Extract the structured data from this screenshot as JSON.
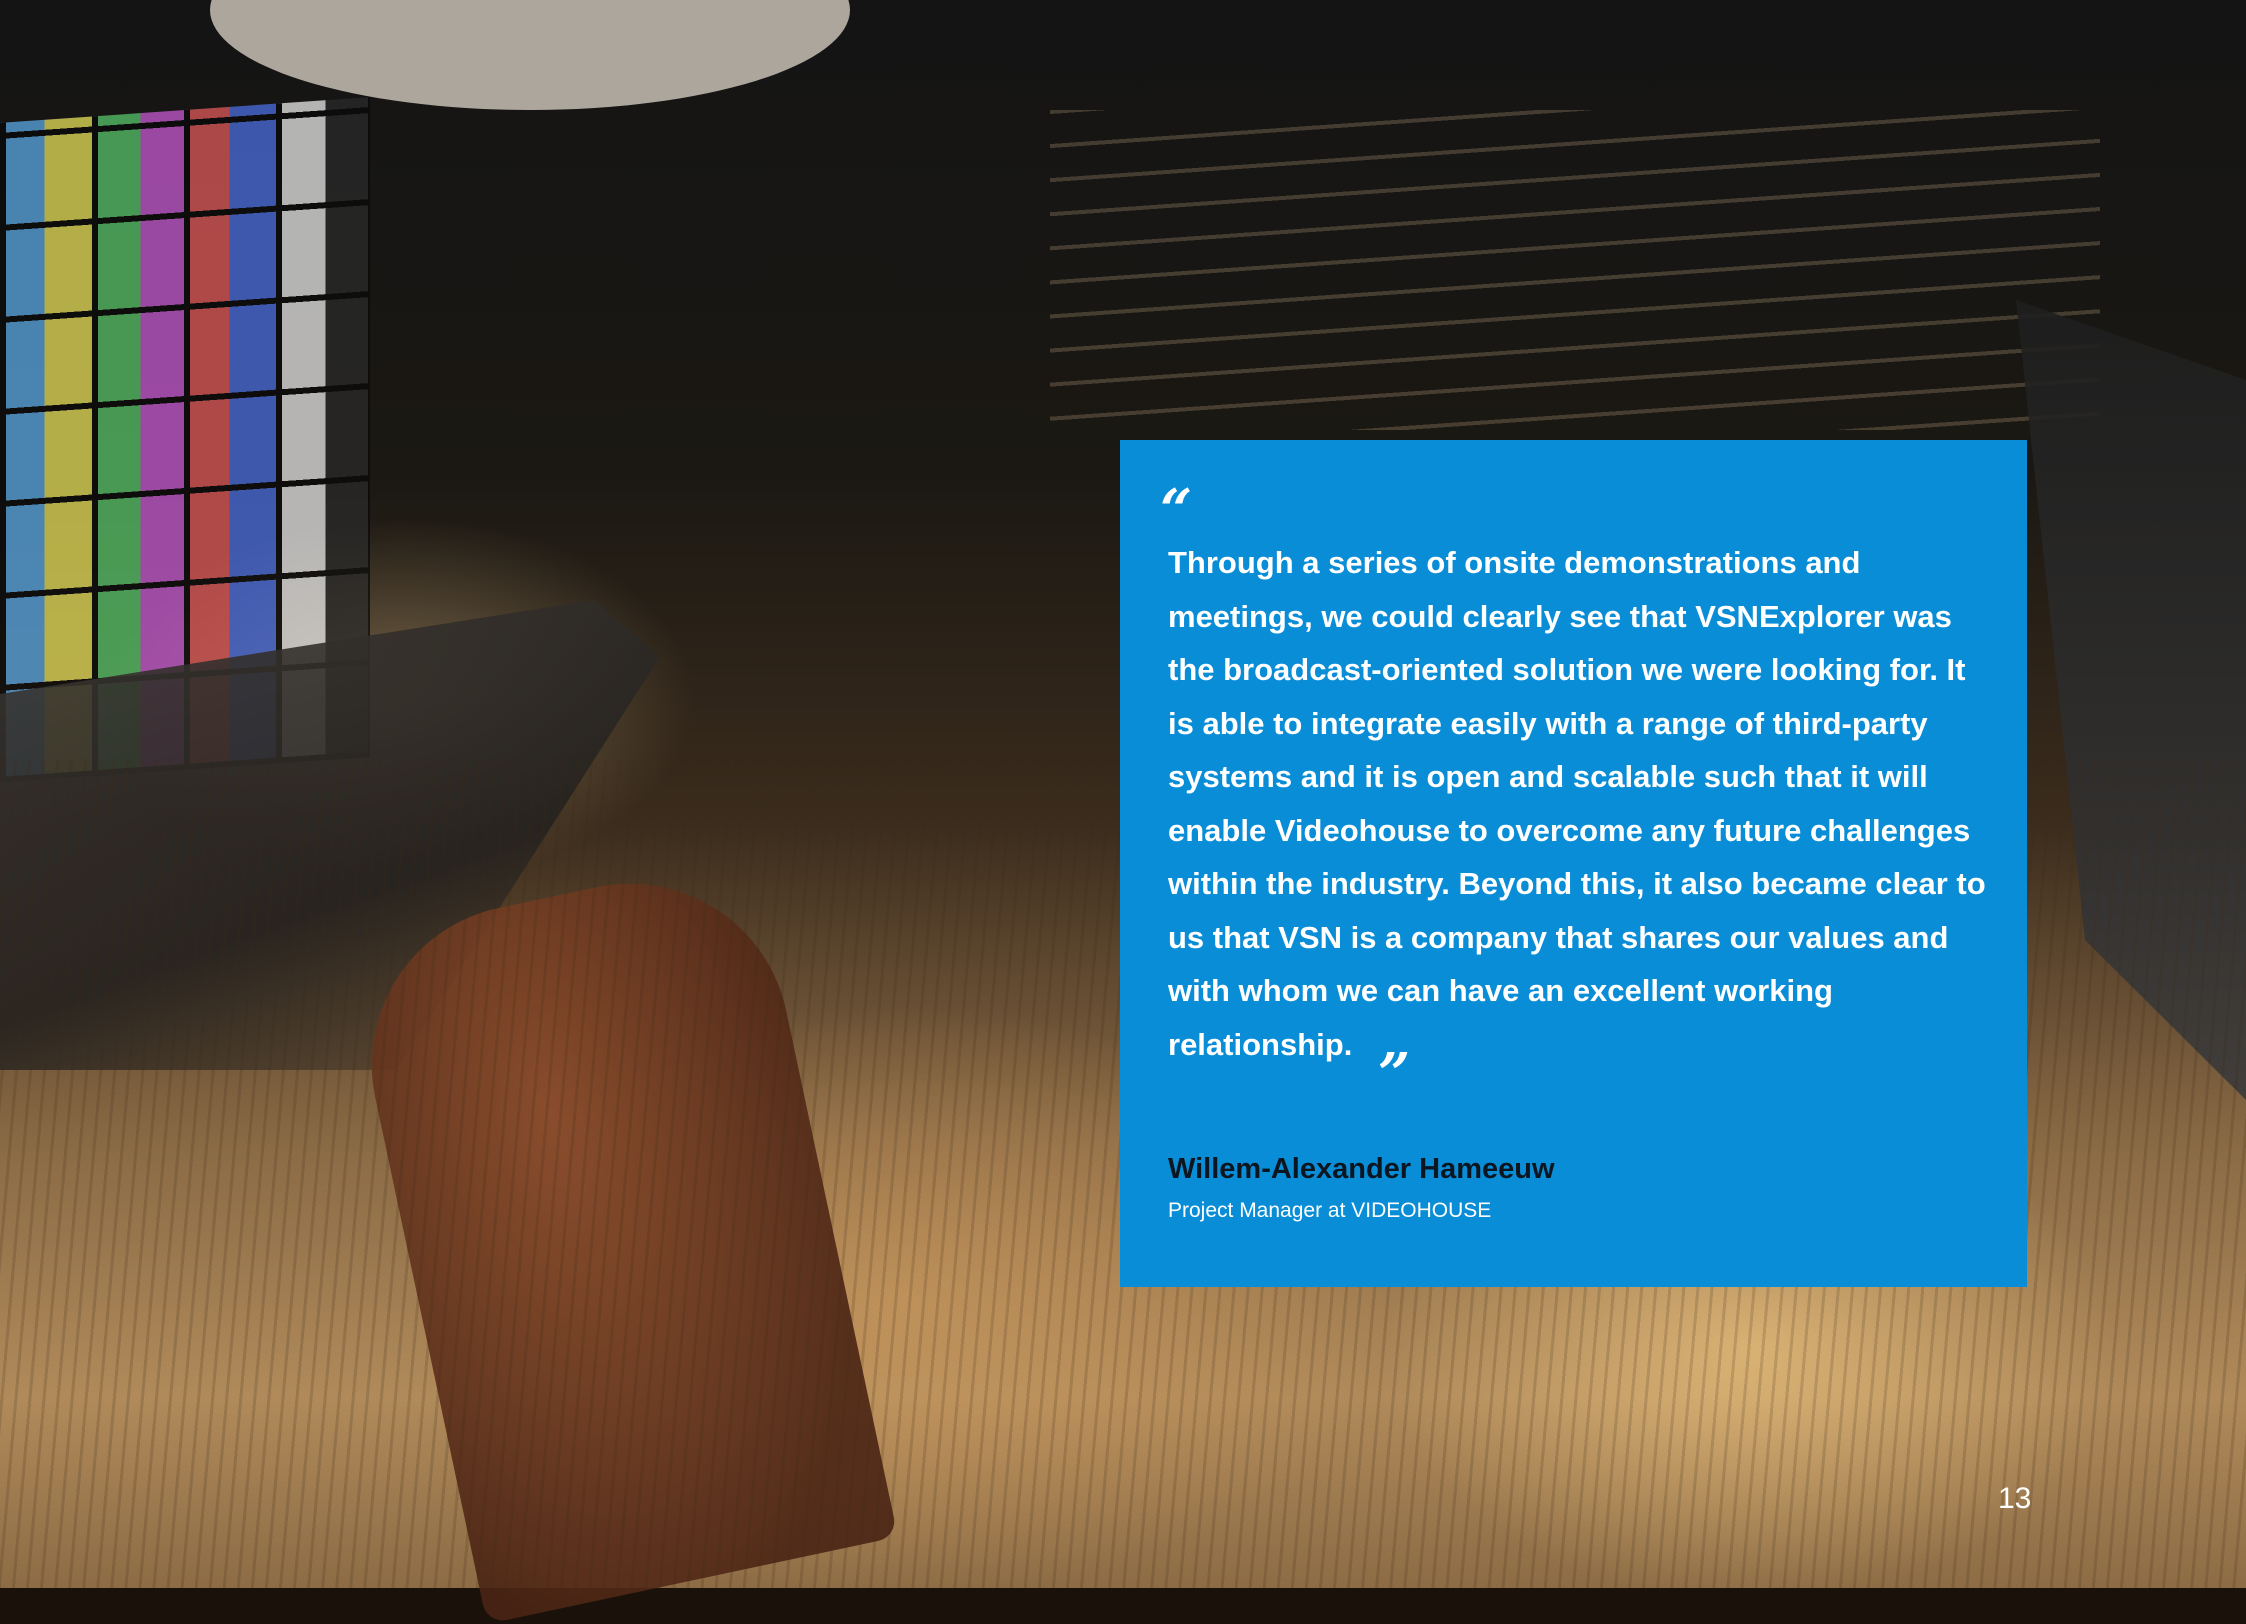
{
  "quote": {
    "open_mark": "“",
    "text": "Through a series of onsite demonstrations and meetings, we could clearly see that VSNExplorer was the broadcast-oriented solution we were looking for. It is able to integrate easily with a range of third-party systems and it is open and scalable such that it will enable Videohouse to overcome any future challenges within the industry. Beyond this, it also became clear to us that VSN is a company that shares our values and with whom we can have an excellent working relationship.",
    "close_mark": "”"
  },
  "author": {
    "name": "Willem-Alexander Hameeuw",
    "role": "Project Manager at VIDEOHOUSE"
  },
  "page_number": "13",
  "colors": {
    "panel": "#0a8dd7",
    "text": "#ffffff",
    "author_name": "#0b1620"
  }
}
